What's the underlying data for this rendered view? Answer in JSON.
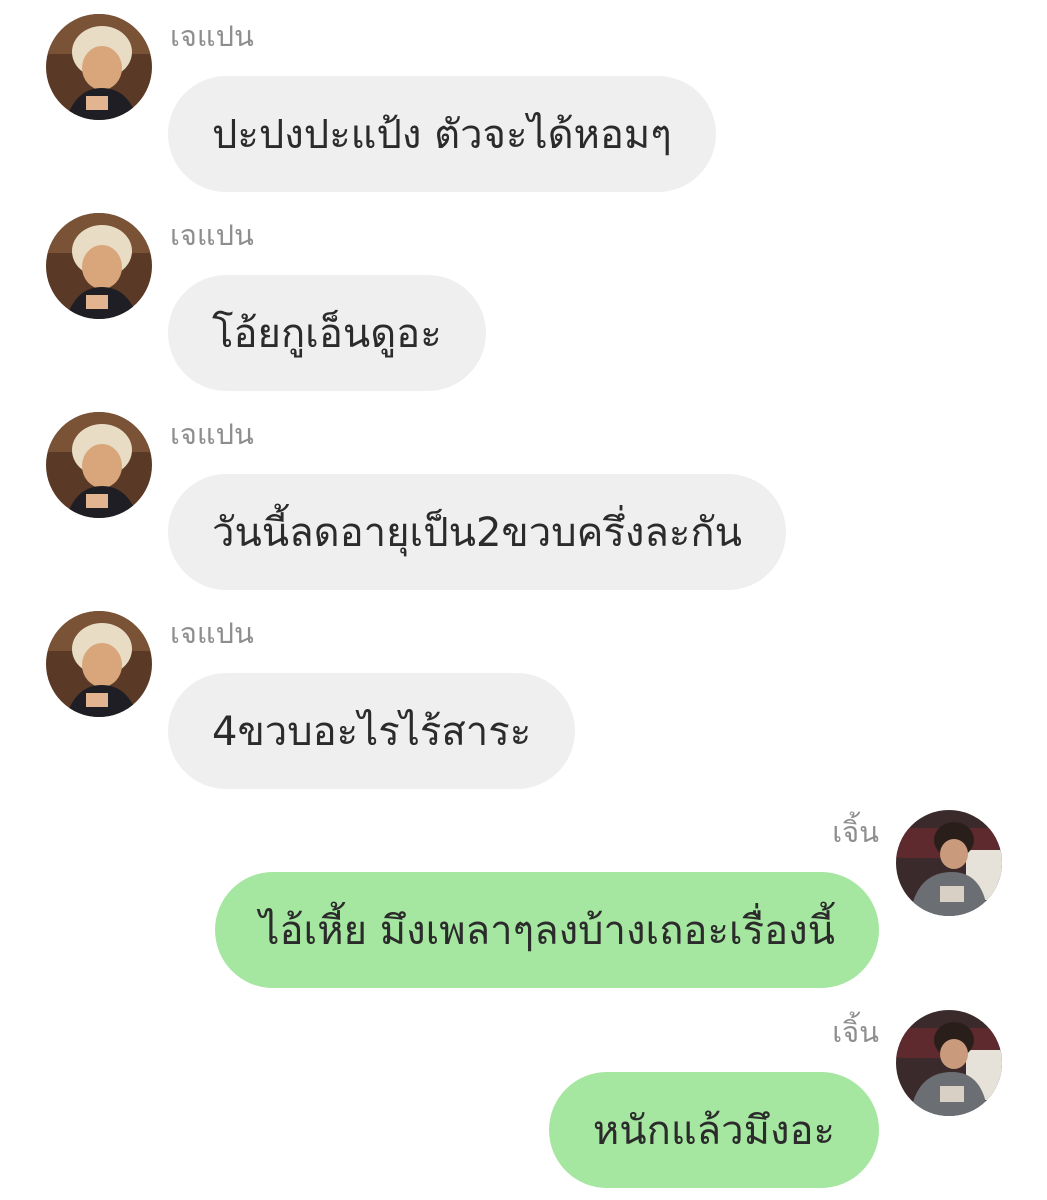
{
  "messages": [
    {
      "sender": "เจแปน",
      "text": "ปะปงปะแป้ง ตัวจะได้หอมๆ",
      "direction": "incoming"
    },
    {
      "sender": "เจแปน",
      "text": "โอ้ยกูเอ็นดูอะ",
      "direction": "incoming"
    },
    {
      "sender": "เจแปน",
      "text": "วันนี้ลดอายุเป็น2ขวบครึ่งละกัน",
      "direction": "incoming"
    },
    {
      "sender": "เจแปน",
      "text": "4ขวบอะไรไร้สาระ",
      "direction": "incoming"
    },
    {
      "sender": "เจิ้น",
      "text": "ไอ้เหี้ย มึงเพลาๆลงบ้างเถอะเรื่องนี้",
      "direction": "outgoing"
    },
    {
      "sender": "เจิ้น",
      "text": "หนักแล้วมึงอะ",
      "direction": "outgoing"
    }
  ],
  "colors": {
    "incoming_bubble": "#efefef",
    "outgoing_bubble": "#a5e6a0",
    "sender_name": "#8e8e8e",
    "message_text": "#2b2b2b"
  }
}
